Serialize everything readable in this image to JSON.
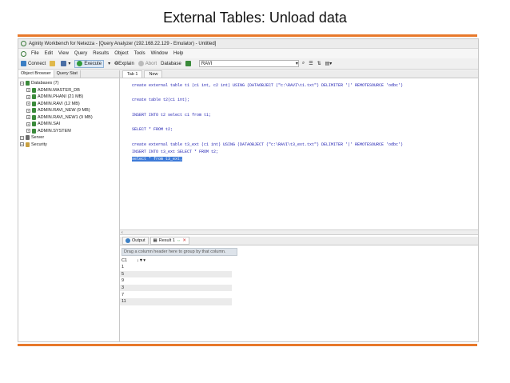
{
  "slide_title": "External Tables: Unload data",
  "app": {
    "window_title": "Aginity Workbench for Netezza - [Query Analyzer (192.168.22.129 - Emulator) - Untitled]",
    "menu": [
      "File",
      "Edit",
      "View",
      "Query",
      "Results",
      "Object",
      "Tools",
      "Window",
      "Help"
    ],
    "toolbar": {
      "connect": "Connect",
      "execute": "Execute",
      "explain": "Explain",
      "abort": "Abort",
      "database_label": "Database",
      "database_value": "RAVI"
    },
    "left_tabs": [
      "Object Browser",
      "Query Stat"
    ],
    "tree": {
      "databases": "Databases (7)",
      "items": [
        "ADMIN.MASTER_DB",
        "ADMIN.PHANI (21 MB)",
        "ADMIN.RAVI (12 MB)",
        "ADMIN.RAVI_NEW (9 MB)",
        "ADMIN.RAVI_NEW1 (9 MB)",
        "ADMIN.SAI",
        "ADMIN.SYSTEM"
      ],
      "server": "Server",
      "security": "Security"
    },
    "doc_tabs": [
      "Tab 1",
      "New"
    ],
    "code_lines": [
      "create external table t1 (c1 int, c2 int) USING (DATAOBJECT (\"c:\\RAVI\\t1.txt\") DELIMITER '|' REMOTESOURCE 'odbc')",
      "",
      "create table t2(c1 int);",
      "",
      "INSERT INTO t2 select c1 from t1;",
      "",
      "SELECT * FROM t2;",
      "",
      "create external table t3_ext (c1 int) USING (DATAOBJECT (\"c:\\RAVI\\t3_ext.txt\") DELIMITER '|' REMOTESOURCE 'odbc')",
      "INSERT INTO t3_ext SELECT * FROM t2;",
      "select * from t3_ext;"
    ],
    "result_tabs": [
      "Output",
      "Result 1"
    ],
    "group_hint": "Drag a column header here to group by that column.",
    "column_header": "C1",
    "rows": [
      "1",
      "5",
      "9",
      "3",
      "7",
      "11"
    ]
  }
}
